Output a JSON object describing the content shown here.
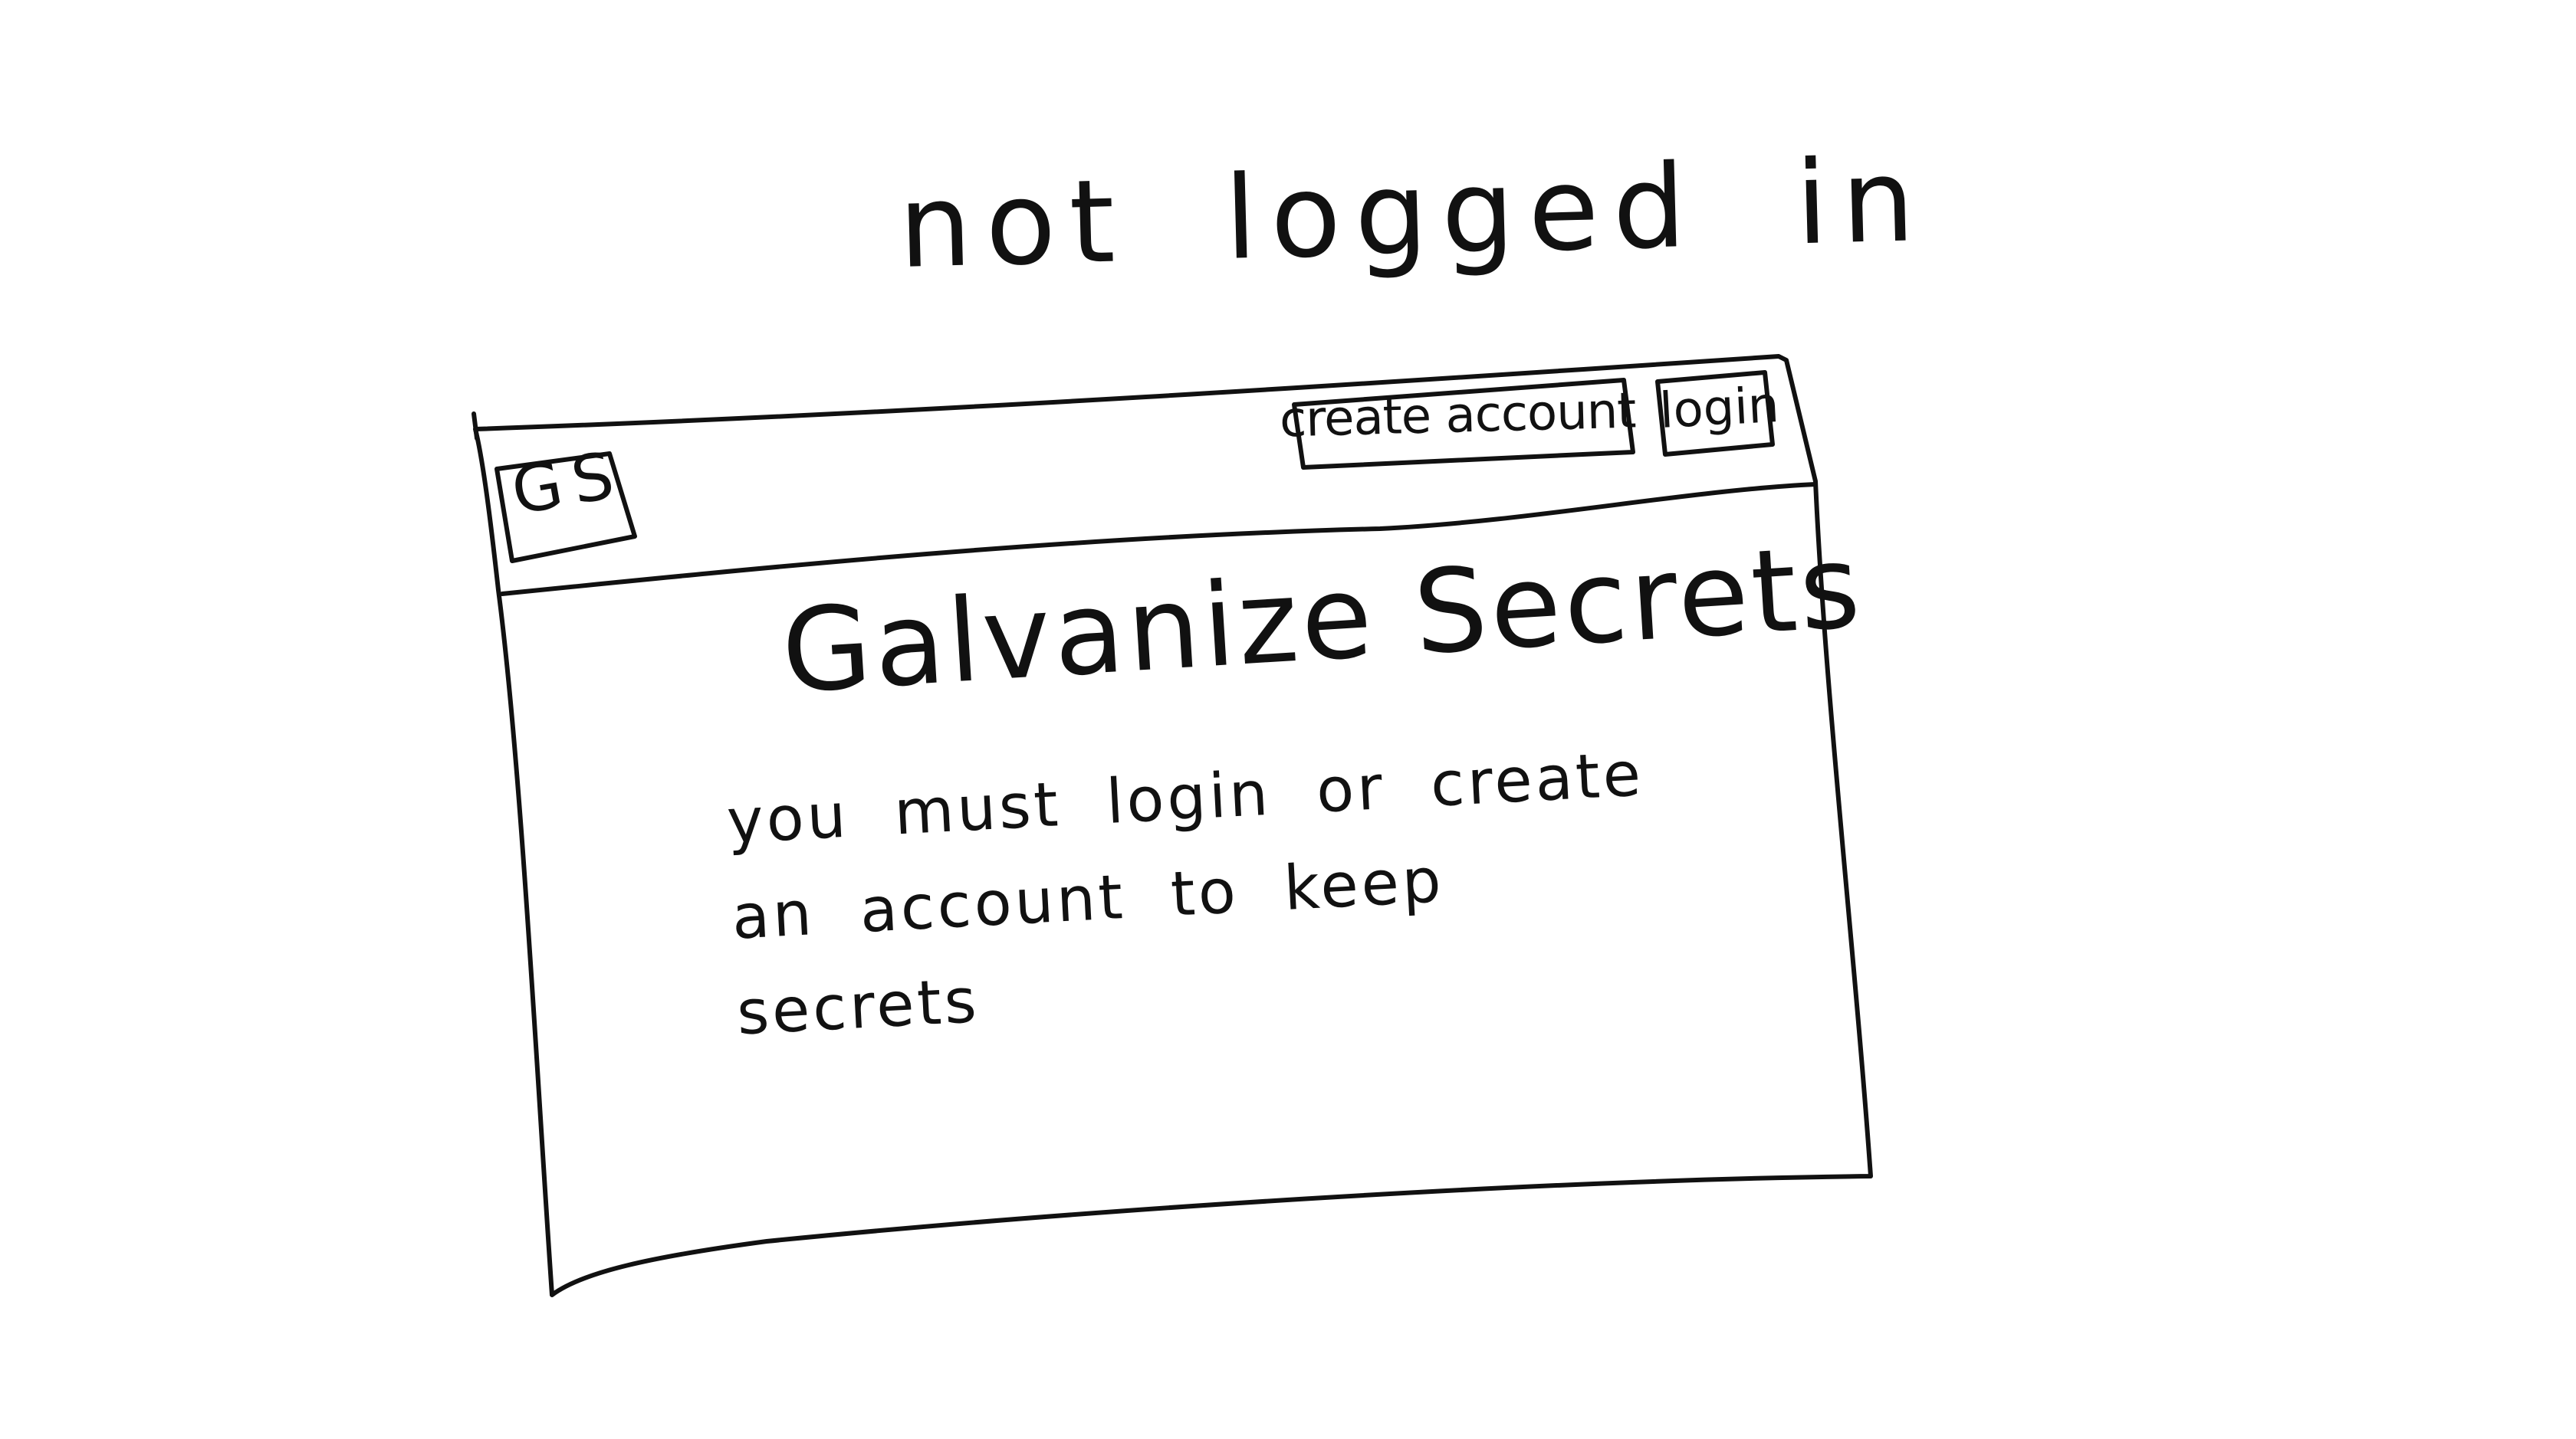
{
  "caption": "not logged in",
  "window": {
    "logo": "GS",
    "nav": {
      "create_account_label": "create account",
      "login_label": "login"
    },
    "main": {
      "title": "Galvanize Secrets",
      "message": "you must login or create an account to keep secrets"
    }
  },
  "colors": {
    "ink": "#111111",
    "paper": "#ffffff"
  }
}
